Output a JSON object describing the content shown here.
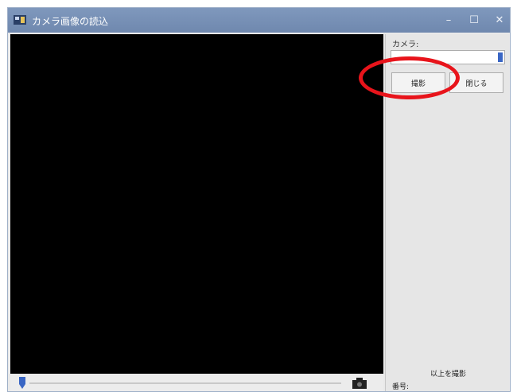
{
  "window": {
    "title": "カメラ画像の読込",
    "minimize_glyph": "–",
    "maximize_glyph": "☐",
    "close_glyph": "✕"
  },
  "panel": {
    "camera_label": "カメラ:",
    "camera_value": "",
    "capture_button": "撮影",
    "close_button": "閉じる",
    "status_text": "以上を撮影",
    "status_label": "番号:"
  },
  "icons": {
    "app": "camera-app-icon",
    "seek_thumb": "slider-thumb-icon",
    "camera": "camera-icon"
  },
  "colors": {
    "titlebar": "#7f98bd",
    "video_background": "#000000",
    "highlight": "#e8141b",
    "select_arrow": "#3a66c4"
  }
}
